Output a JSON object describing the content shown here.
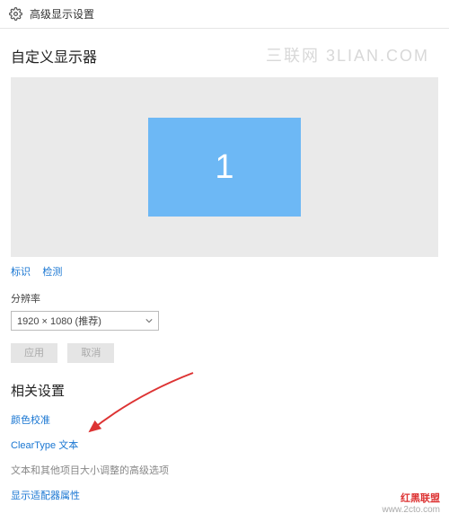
{
  "header": {
    "title": "高级显示设置"
  },
  "section1": {
    "title": "自定义显示器",
    "monitor_number": "1",
    "links": {
      "identify": "标识",
      "detect": "检测"
    }
  },
  "resolution": {
    "label": "分辨率",
    "selected": "1920 × 1080 (推荐)"
  },
  "buttons": {
    "apply": "应用",
    "cancel": "取消"
  },
  "related": {
    "title": "相关设置",
    "items": [
      "颜色校准",
      "ClearType 文本",
      "文本和其他项目大小调整的高级选项",
      "显示适配器属性"
    ]
  },
  "watermarks": {
    "top": "三联网 3LIAN.COM",
    "bottom_line1": "红黑联盟",
    "bottom_line2": "www.2cto.com"
  }
}
